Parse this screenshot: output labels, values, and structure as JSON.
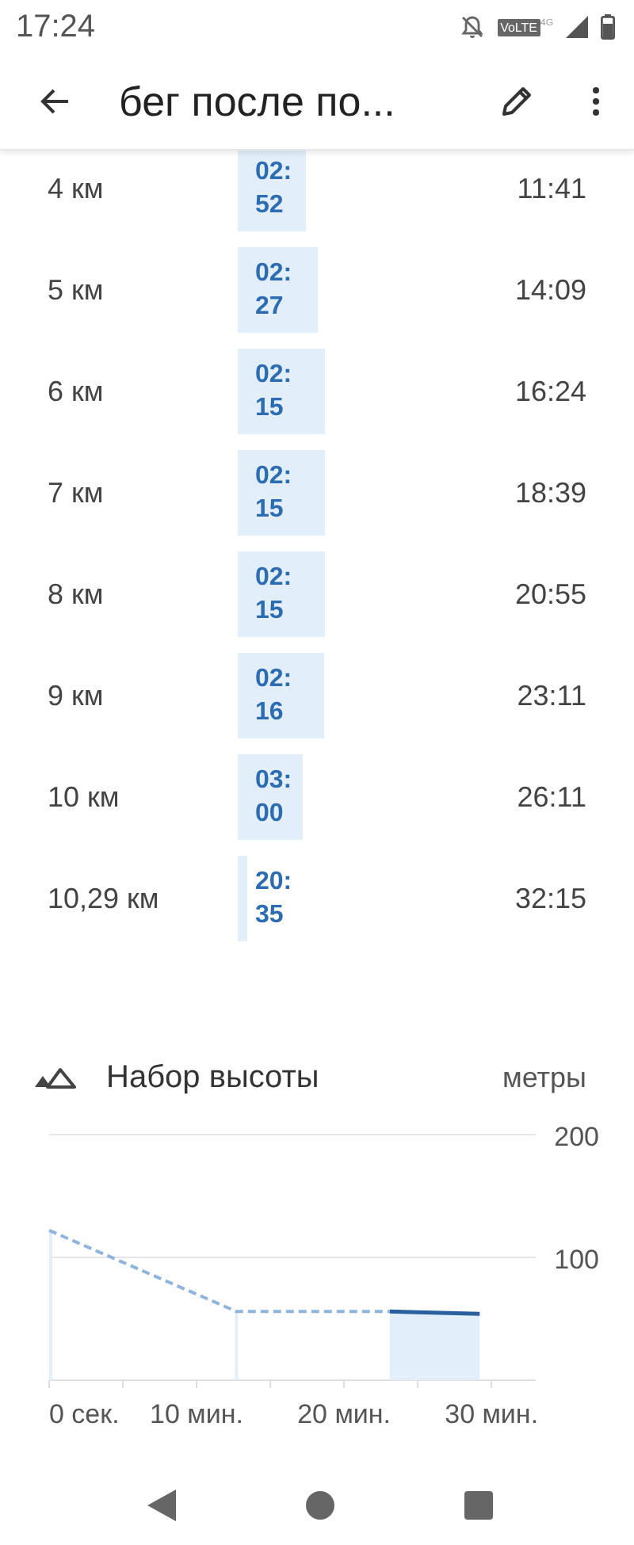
{
  "status_bar": {
    "time": "17:24",
    "network": "VoLTE",
    "network_sup": "4G"
  },
  "app_bar": {
    "title": "бег после по..."
  },
  "splits": [
    {
      "distance": "4 км",
      "pace": "02:52",
      "time": "11:41"
    },
    {
      "distance": "5 км",
      "pace": "02:27",
      "time": "14:09"
    },
    {
      "distance": "6 км",
      "pace": "02:15",
      "time": "16:24"
    },
    {
      "distance": "7 км",
      "pace": "02:15",
      "time": "18:39"
    },
    {
      "distance": "8 км",
      "pace": "02:15",
      "time": "20:55"
    },
    {
      "distance": "9 км",
      "pace": "02:16",
      "time": "23:11"
    },
    {
      "distance": "10 км",
      "pace": "03:00",
      "time": "26:11"
    },
    {
      "distance": "10,29 км",
      "pace": "20:35",
      "time": "32:15"
    }
  ],
  "elevation": {
    "title": "Набор высоты",
    "unit": "метры",
    "chart_data": {
      "type": "area",
      "x": [
        0,
        12.7,
        23.1,
        29.2
      ],
      "series": [
        {
          "type": "line",
          "color": "#8fb4de",
          "line_style": "dashed",
          "values": [
            122,
            56,
            56,
            null
          ]
        },
        {
          "type": "area",
          "color": "#2a5f9e",
          "line_style": "solid",
          "values": [
            null,
            null,
            56,
            54
          ]
        }
      ],
      "xlim": [
        0,
        33
      ],
      "ylim": [
        0,
        200
      ],
      "xticks": [
        {
          "value": 0,
          "label": "0 сек."
        },
        {
          "value": 10,
          "label": "10 мин."
        },
        {
          "value": 20,
          "label": "20 мин."
        },
        {
          "value": 30,
          "label": "30 мин."
        }
      ],
      "yticks": [
        100,
        200
      ]
    }
  }
}
